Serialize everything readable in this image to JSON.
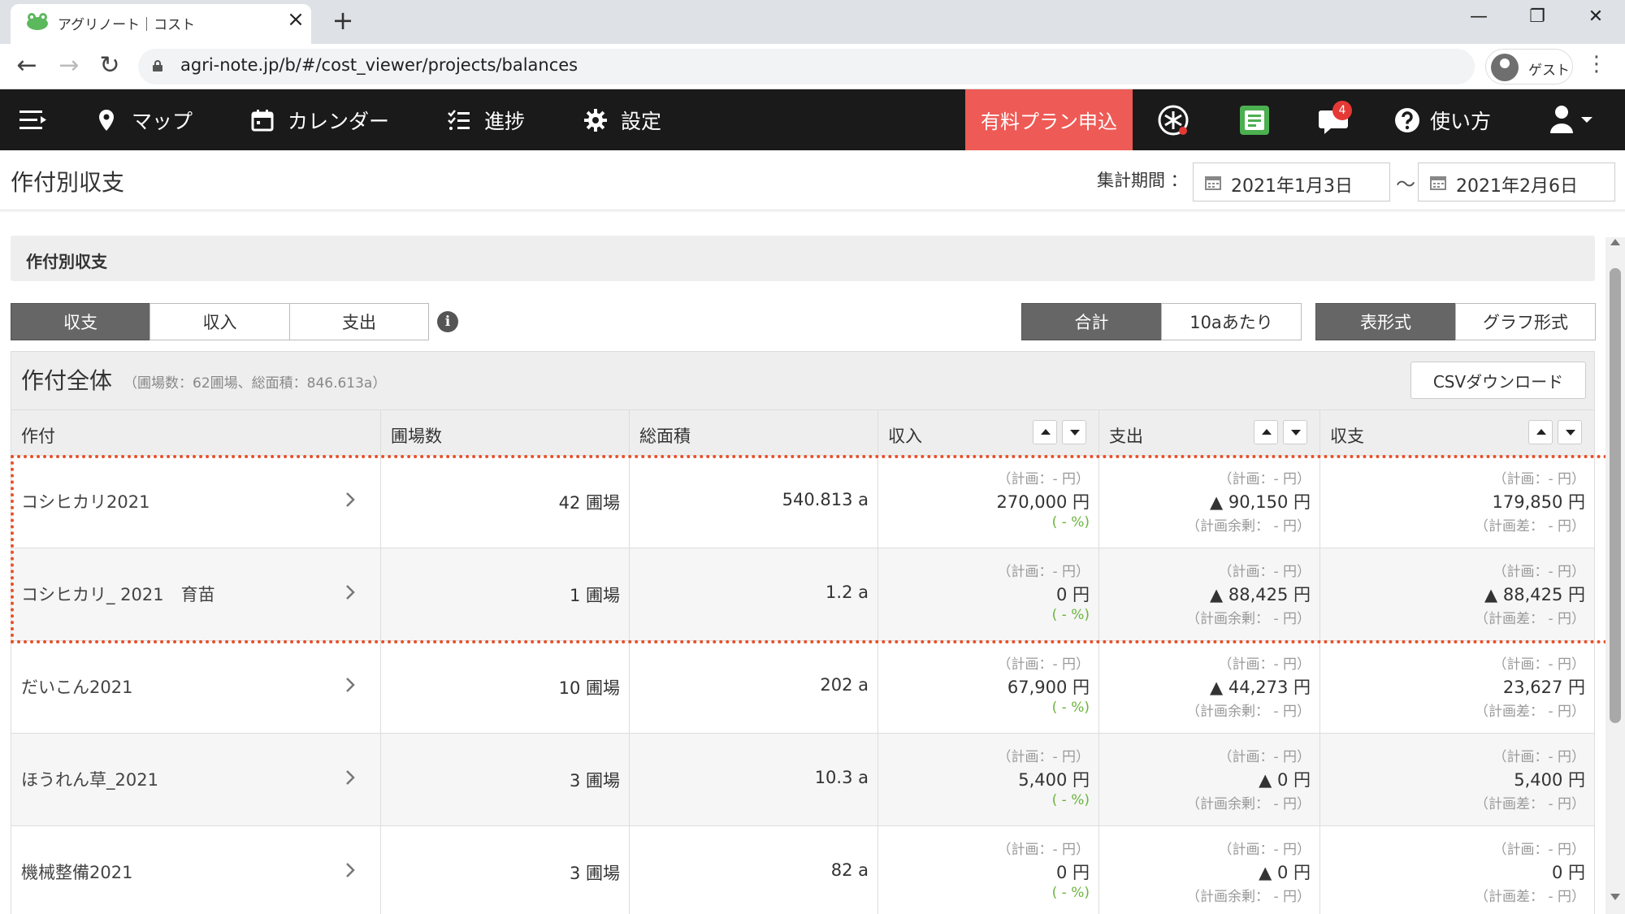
{
  "browser": {
    "tab_title": "アグリノート｜コスト",
    "url": "agri-note.jp/b/#/cost_viewer/projects/balances",
    "profile_name": "ゲスト"
  },
  "nav": {
    "map": "マップ",
    "calendar": "カレンダー",
    "progress": "進捗",
    "settings": "設定",
    "plan_button": "有料プラン申込",
    "notification_count": "4",
    "help": "使い方"
  },
  "page": {
    "title": "作付別収支",
    "period_label": "集計期間 ：",
    "date_from": "2021年1月3日",
    "date_separator": "〜",
    "date_to": "2021年2月6日"
  },
  "section": {
    "title": "作付別収支",
    "tabs": [
      "収支",
      "収入",
      "支出"
    ],
    "unit_toggle": [
      "合計",
      "10aあたり"
    ],
    "view_toggle": [
      "表形式",
      "グラフ形式"
    ]
  },
  "table": {
    "title": "作付全体",
    "subtitle": "（圃場数：62圃場、総面積：846.613a）",
    "csv_button": "CSVダウンロード",
    "columns": [
      "作付",
      "圃場数",
      "総面積",
      "収入",
      "支出",
      "収支"
    ],
    "rows": [
      {
        "crop": "コシヒカリ2021",
        "fields": "42 圃場",
        "area": "540.813 a",
        "income_plan": "（計画：- 円）",
        "income": "270,000 円",
        "income_pct": "( - %)",
        "expense_plan": "（計画：- 円）",
        "expense": "▲ 90,150 円",
        "expense_remain": "（計画余剰： - 円）",
        "balance_plan": "（計画：- 円）",
        "balance": "179,850 円",
        "balance_diff": "（計画差： - 円）"
      },
      {
        "crop": "コシヒカリ_ 2021　育苗",
        "fields": "1 圃場",
        "area": "1.2 a",
        "income_plan": "（計画：- 円）",
        "income": "0 円",
        "income_pct": "( - %)",
        "expense_plan": "（計画：- 円）",
        "expense": "▲ 88,425 円",
        "expense_remain": "（計画余剰： - 円）",
        "balance_plan": "（計画：- 円）",
        "balance": "▲ 88,425 円",
        "balance_diff": "（計画差： - 円）"
      },
      {
        "crop": "だいこん2021",
        "fields": "10 圃場",
        "area": "202 a",
        "income_plan": "（計画：- 円）",
        "income": "67,900 円",
        "income_pct": "( - %)",
        "expense_plan": "（計画：- 円）",
        "expense": "▲ 44,273 円",
        "expense_remain": "（計画余剰： - 円）",
        "balance_plan": "（計画：- 円）",
        "balance": "23,627 円",
        "balance_diff": "（計画差： - 円）"
      },
      {
        "crop": "ほうれん草_2021",
        "fields": "3 圃場",
        "area": "10.3 a",
        "income_plan": "（計画：- 円）",
        "income": "5,400 円",
        "income_pct": "( - %)",
        "expense_plan": "（計画：- 円）",
        "expense": "▲ 0 円",
        "expense_remain": "（計画余剰： - 円）",
        "balance_plan": "（計画：- 円）",
        "balance": "5,400 円",
        "balance_diff": "（計画差： - 円）"
      },
      {
        "crop": "機械整備2021",
        "fields": "3 圃場",
        "area": "82 a",
        "income_plan": "（計画：- 円）",
        "income": "0 円",
        "income_pct": "( - %)",
        "expense_plan": "（計画：- 円）",
        "expense": "▲ 0 円",
        "expense_remain": "（計画余剰： - 円）",
        "balance_plan": "（計画：- 円）",
        "balance": "0 円",
        "balance_diff": "（計画差： - 円）"
      }
    ]
  },
  "colors": {
    "header_bg": "#1a1a1a",
    "plan_button_bg": "#ee5a55",
    "highlight_border": "#e8502a",
    "percent_text": "#6ab43b"
  }
}
